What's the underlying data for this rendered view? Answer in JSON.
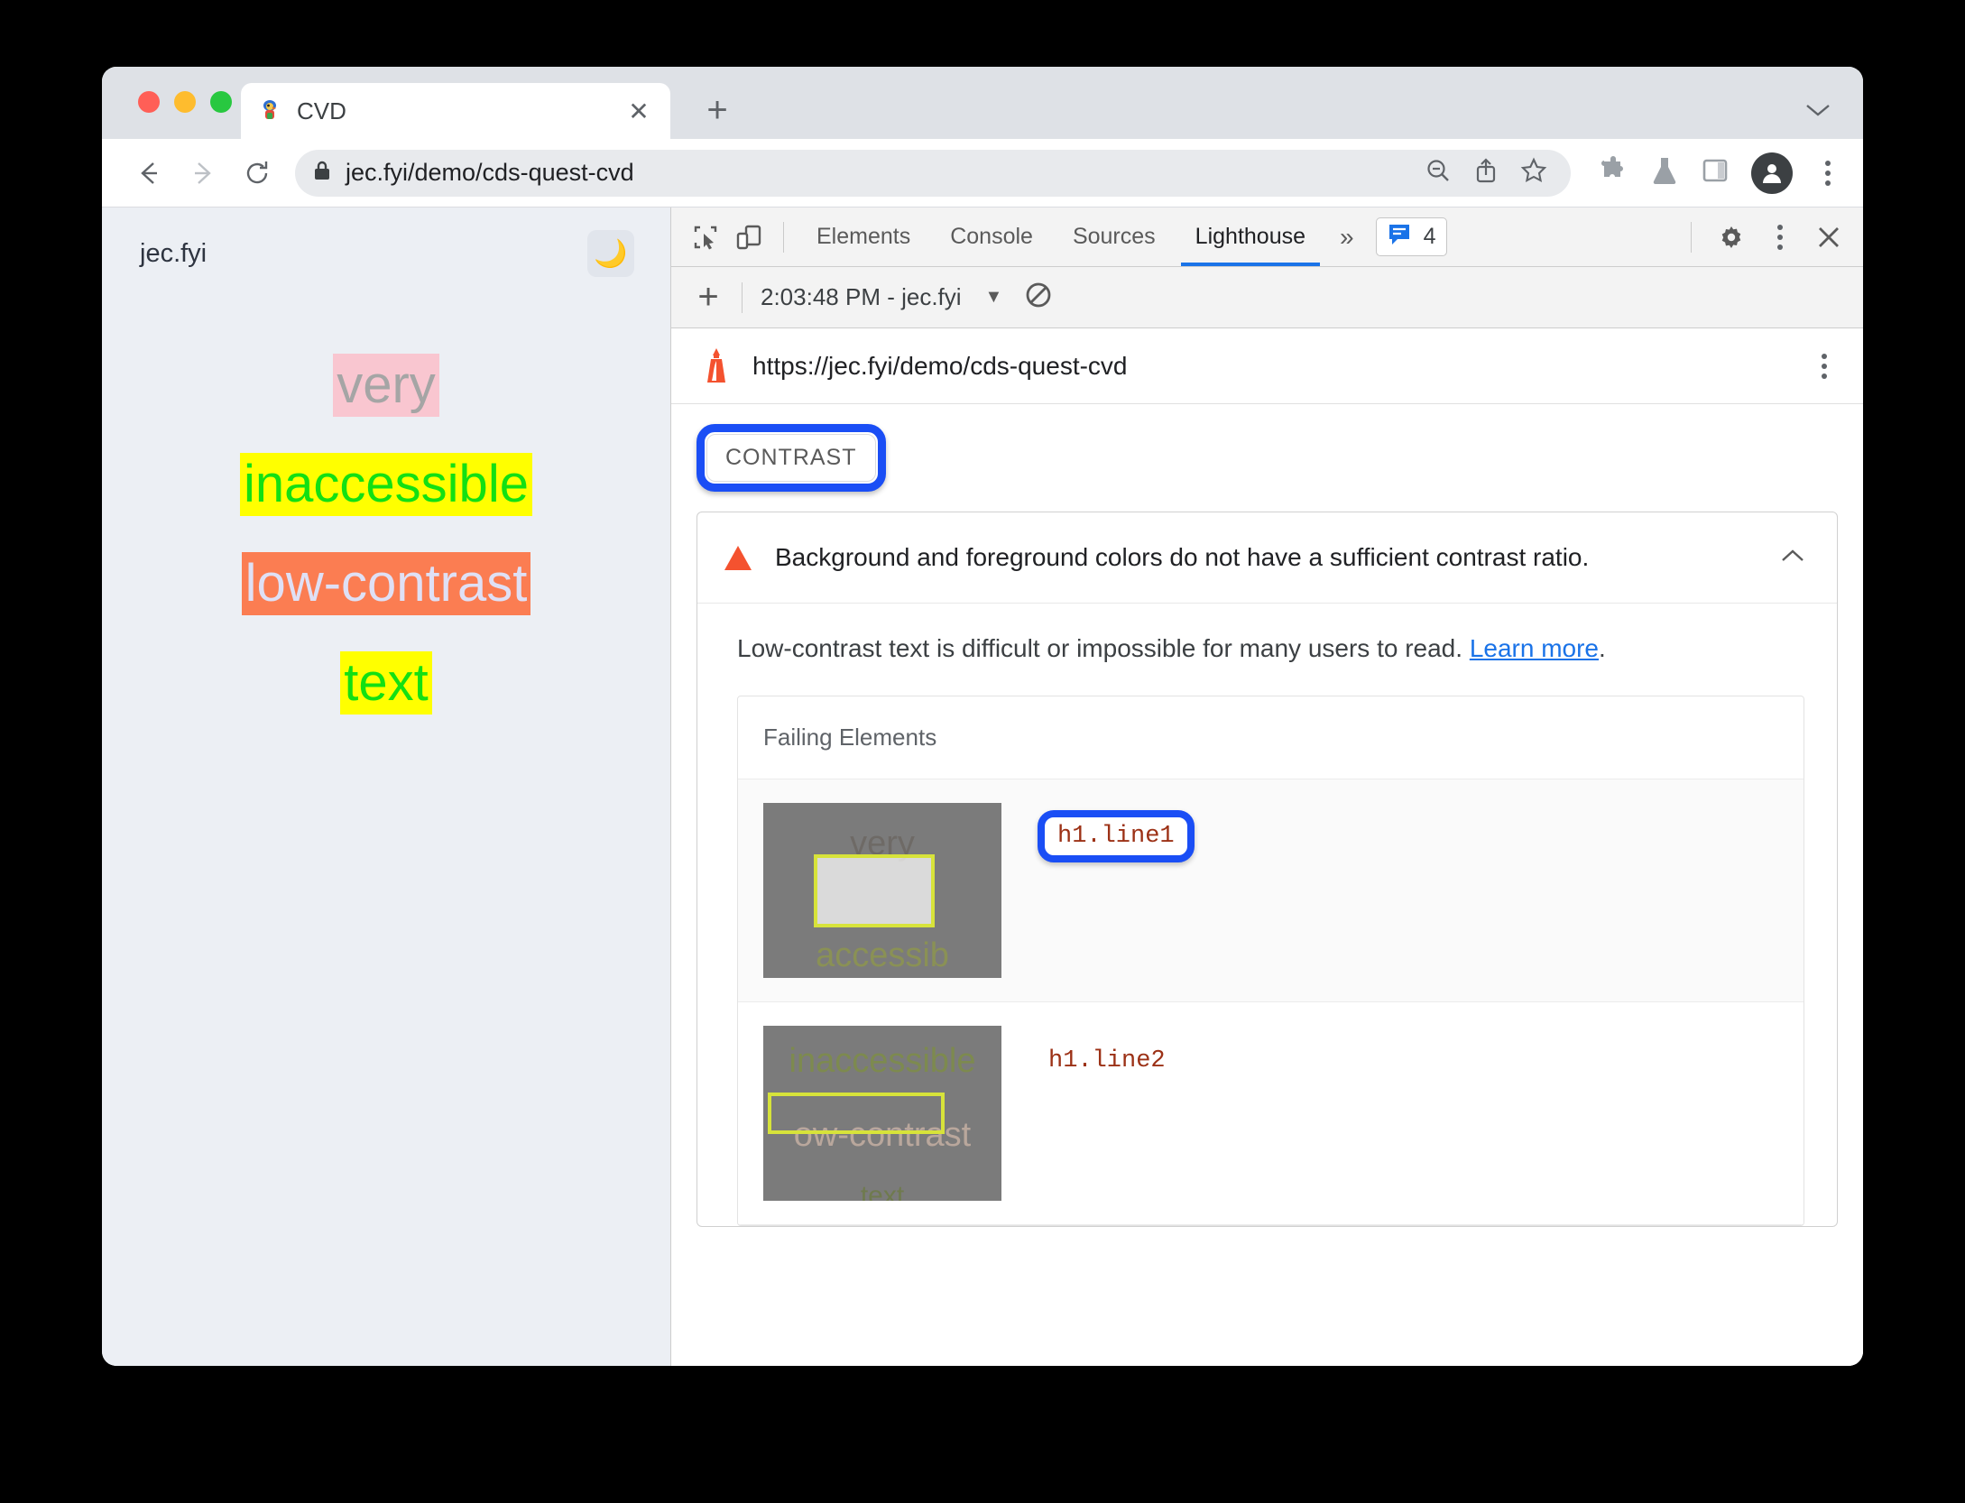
{
  "browser": {
    "tab": {
      "title": "CVD",
      "favicon_icon": "parrot-favicon",
      "close_icon": "close-icon"
    },
    "new_tab_icon": "plus-icon",
    "window_chevron_icon": "chevron-down-icon",
    "nav": {
      "back_icon": "back-arrow-icon",
      "forward_icon": "forward-arrow-icon",
      "reload_icon": "reload-icon"
    },
    "omnibox": {
      "lock_icon": "lock-icon",
      "url": "jec.fyi/demo/cds-quest-cvd",
      "zoom_out_icon": "zoom-out-icon",
      "share_icon": "share-icon",
      "bookmark_icon": "star-icon"
    },
    "toolbar_icons": [
      "puzzle-icon",
      "flask-icon",
      "side-panel-icon",
      "profile-avatar-icon",
      "kebab-menu-icon"
    ]
  },
  "page": {
    "site_name": "jec.fyi",
    "theme_toggle_icon": "moon-icon",
    "lines": [
      {
        "text": "very",
        "color": "#a5a5a5",
        "background": "#f9c6d0"
      },
      {
        "text": "inaccessible",
        "color": "#13e013",
        "background": "#ffff00"
      },
      {
        "text": "low-contrast",
        "color": "#dfe0f5",
        "background": "#fb7d52"
      },
      {
        "text": "text",
        "color": "#13e013",
        "background": "#ffff00"
      }
    ]
  },
  "devtools": {
    "inspect_icon": "inspect-element-icon",
    "device_icon": "device-toolbar-icon",
    "tabs": [
      {
        "label": "Elements",
        "active": false
      },
      {
        "label": "Console",
        "active": false
      },
      {
        "label": "Sources",
        "active": false
      },
      {
        "label": "Lighthouse",
        "active": true
      }
    ],
    "overflow_label": "»",
    "message_badge": {
      "icon": "message-bubble-icon",
      "count": "4"
    },
    "settings_icon": "gear-icon",
    "more_icon": "kebab-menu-icon",
    "close_icon": "close-icon",
    "active_tab_accent": "#1a73e8"
  },
  "lighthouse": {
    "toolbar": {
      "add_icon": "plus-icon",
      "run_label": "2:03:48 PM - jec.fyi",
      "dropdown_icon": "caret-down-icon",
      "clear_icon": "no-entry-icon"
    },
    "report": {
      "logo_icon": "lighthouse-icon",
      "url": "https://jec.fyi/demo/cds-quest-cvd",
      "menu_icon": "kebab-menu-icon",
      "category_badge": "CONTRAST",
      "audit": {
        "warning_icon": "warning-triangle-icon",
        "title": "Background and foreground colors do not have a sufficient contrast ratio.",
        "collapse_icon": "chevron-up-icon",
        "description_prefix": "Low-contrast text is difficult or impossible for many users to read. ",
        "learn_more": "Learn more",
        "description_suffix": ".",
        "failing_elements_title": "Failing Elements",
        "rows": [
          {
            "selector": "h1.line1",
            "highlighted": true
          },
          {
            "selector": "h1.line2",
            "highlighted": false
          }
        ]
      }
    },
    "annotation_color": "#1a4ef5"
  }
}
